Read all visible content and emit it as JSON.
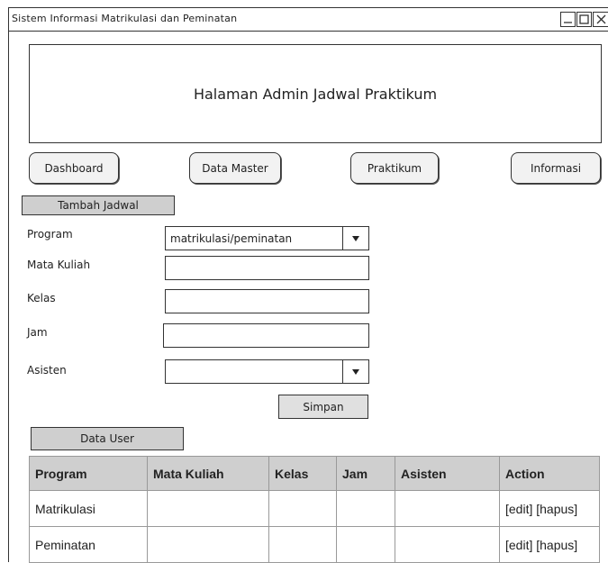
{
  "window": {
    "title": "Sistem Informasi Matrikulasi dan Peminatan"
  },
  "header": {
    "text": "Halaman Admin Jadwal Praktikum"
  },
  "nav": [
    {
      "label": "Dashboard"
    },
    {
      "label": "Data Master"
    },
    {
      "label": "Praktikum"
    },
    {
      "label": "Informasi"
    }
  ],
  "form": {
    "section_label": "Tambah Jadwal",
    "program_label": "Program",
    "program_value": "matrikulasi/peminatan",
    "mata_kuliah_label": "Mata Kuliah",
    "kelas_label": "Kelas",
    "jam_label": "Jam",
    "asisten_label": "Asisten",
    "asisten_value": "",
    "save_label": "Simpan"
  },
  "data_user": {
    "section_label": "Data User",
    "columns": [
      "Program",
      "Mata Kuliah",
      "Kelas",
      "Jam",
      "Asisten",
      "Action"
    ],
    "rows": [
      [
        "Matrikulasi",
        "",
        "",
        "",
        "",
        "[edit] [hapus]"
      ],
      [
        "Peminatan",
        "",
        "",
        "",
        "",
        "[edit] [hapus]"
      ]
    ]
  },
  "icons": {
    "minimize": "minimize-icon",
    "maximize": "maximize-icon",
    "close": "close-icon",
    "dropdown": "chevron-down-icon"
  }
}
